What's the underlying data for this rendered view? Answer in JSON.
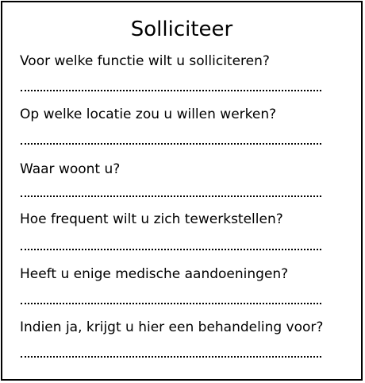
{
  "form": {
    "title": "Solliciteer",
    "questions": [
      {
        "label": "Voor welke functie wilt u solliciteren?"
      },
      {
        "label": "Op welke locatie zou u willen werken?"
      },
      {
        "label": "Waar woont u?"
      },
      {
        "label": "Hoe frequent wilt u zich tewerkstellen?"
      },
      {
        "label": "Heeft u enige medische aandoeningen?"
      },
      {
        "label": "Indien ja, krijgt u hier een behandeling voor?"
      }
    ]
  }
}
